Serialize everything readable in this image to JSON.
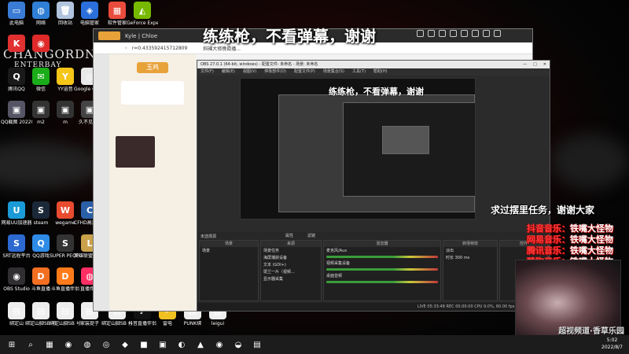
{
  "desktop": {
    "icons_col1": [
      {
        "label": "此电脑",
        "color": "#3a7bd5",
        "glyph": "▭"
      },
      {
        "label": "",
        "color": "#e03030",
        "glyph": "K"
      },
      {
        "label": "腾讯QQ",
        "color": "#1a1a1a",
        "glyph": "Q"
      },
      {
        "label": "QQ截图 20220802...",
        "color": "#556",
        "glyph": "▣"
      },
      {
        "label": "",
        "color": "#222",
        "glyph": ""
      },
      {
        "label": "",
        "color": "#222",
        "glyph": ""
      },
      {
        "label": "网易UU加速器",
        "color": "#1a9bd7",
        "glyph": "U"
      },
      {
        "label": "SRT远程平台",
        "color": "#2c6ad2",
        "glyph": "S"
      },
      {
        "label": "OBS Studio",
        "color": "#302e31",
        "glyph": "◉"
      },
      {
        "label": "绑定山",
        "color": "#eee",
        "glyph": "▤"
      }
    ],
    "icons_col2": [
      {
        "label": "网络",
        "color": "#2f7fd6",
        "glyph": "◍"
      },
      {
        "label": "",
        "color": "#e02a2a",
        "glyph": "◉"
      },
      {
        "label": "微信",
        "color": "#1aad19",
        "glyph": "✉"
      },
      {
        "label": "m2",
        "color": "#333",
        "glyph": "▣"
      },
      {
        "label": "",
        "color": "#222",
        "glyph": ""
      },
      {
        "label": "",
        "color": "#222",
        "glyph": ""
      },
      {
        "label": "steam",
        "color": "#1b2838",
        "glyph": "S"
      },
      {
        "label": "QQ游戏",
        "color": "#2e8be6",
        "glyph": "Q"
      },
      {
        "label": "斗鱼直播",
        "color": "#f36f21",
        "glyph": "D"
      },
      {
        "label": "绑定山脚SB 号 1",
        "color": "#eee",
        "glyph": "▤"
      }
    ],
    "icons_col3": [
      {
        "label": "回收站",
        "color": "#b0c4de",
        "glyph": "🗑"
      },
      {
        "label": "",
        "color": "#e8e8e8",
        "glyph": ""
      },
      {
        "label": "YY语音",
        "color": "#f5c518",
        "glyph": "Y"
      },
      {
        "label": "m",
        "color": "#333",
        "glyph": "▣"
      },
      {
        "label": "",
        "color": "#222",
        "glyph": ""
      },
      {
        "label": "",
        "color": "#222",
        "glyph": ""
      },
      {
        "label": "wegame",
        "color": "#e84b2f",
        "glyph": "W"
      },
      {
        "label": "SUPER PEOPLE CBT",
        "color": "#333",
        "glyph": "S"
      },
      {
        "label": "斗鱼直播伴侣",
        "color": "#ff7b1a",
        "glyph": "D"
      },
      {
        "label": "绑定山脚SB 号 2",
        "color": "#eee",
        "glyph": "▤"
      }
    ],
    "icons_col4": [
      {
        "label": "电脑管家",
        "color": "#2a6fdb",
        "glyph": "◈"
      },
      {
        "label": "",
        "color": "#ddd",
        "glyph": ""
      },
      {
        "label": "Google Chrome",
        "color": "#e8e8e8",
        "glyph": "◎"
      },
      {
        "label": "久不见: 自",
        "color": "#444",
        "glyph": "▣"
      },
      {
        "label": "",
        "color": "#222",
        "glyph": ""
      },
      {
        "label": "",
        "color": "#222",
        "glyph": ""
      },
      {
        "label": "CFHD高清 竞技大区",
        "color": "#2b5fa8",
        "glyph": "C"
      },
      {
        "label": "英雄联盟 WeGame版",
        "color": "#c9a14a",
        "glyph": "L"
      },
      {
        "label": "直播伴侣",
        "color": "#ff2f64",
        "glyph": "◍"
      },
      {
        "label": "家装提子",
        "color": "#eee",
        "glyph": "▤"
      }
    ],
    "icons_extra": [
      {
        "label": "软件管家",
        "color": "#e94b3c",
        "glyph": "▦"
      },
      {
        "label": "GeForce Experience",
        "color": "#76b900",
        "glyph": "◭"
      },
      {
        "label": "绑定山脚SB 号 4",
        "color": "#eee",
        "glyph": "▤"
      },
      {
        "label": "抖音直播伴侣",
        "color": "#111",
        "glyph": "♪"
      },
      {
        "label": "雷电",
        "color": "#f0c020",
        "glyph": "⚡"
      },
      {
        "label": "PUNK绑",
        "color": "#eee",
        "glyph": "▤"
      },
      {
        "label": "leigui",
        "color": "#eee",
        "glyph": "▤"
      }
    ],
    "logo_line1": "CHANGORDN",
    "logo_line2": "ENTERBAY"
  },
  "banner_text": "练练枪，不看弹幕，谢谢",
  "browser": {
    "tab_text": "Kyle | Chloe",
    "url": "r=0.433592415712809",
    "page_title": "斜裸大修晚霞播...",
    "content_brand": "玉鸡"
  },
  "obs": {
    "window_title": "OBS 27.0.1 (64-bit, windows) - 配置文件: 未命名 - 场景: 未命名",
    "menu": [
      "文件(F)",
      "编辑(E)",
      "视图(V)",
      "停靠部件(D)",
      "配置文件(P)",
      "场景集合(S)",
      "工具(T)",
      "帮助(H)"
    ],
    "preview_banner": "练练枪，不看弹幕，谢谢",
    "dock_label": "未选择源",
    "props_button": "属性",
    "filters_button": "滤镜",
    "scenes_header": "场景",
    "scenes": [
      "场景"
    ],
    "sources_header": "来源",
    "sources": [
      "场景任务",
      "海屏捕获设备",
      "文本 (GDI+)",
      "斑兰一片（视频...",
      "显示器采集"
    ],
    "mixer_header": "混音器",
    "mixer": [
      {
        "name": "麦克风/Aux",
        "db": "0.0 dB"
      },
      {
        "name": "视频采集设备",
        "db": "0.0 dB"
      },
      {
        "name": "桌面音频",
        "db": "0.0 dB"
      }
    ],
    "transitions_header": "转场特效",
    "transition": "淡出",
    "duration_label": "时长",
    "duration": "300 ms",
    "controls_header": "控件",
    "status": "LIVE 05:33:48   REC 00:00:00   CPU 9.0%, 60.00 fps"
  },
  "overlay": {
    "thanks": "求过摆里任务，谢谢大家",
    "music_lines": [
      {
        "label": "抖音音乐：",
        "value": "铁嘴大怪物"
      },
      {
        "label": "网易音乐：",
        "value": "铁嘴大怪物"
      },
      {
        "label": "腾讯音乐：",
        "value": "铁嘴大怪物"
      },
      {
        "label": "酷狗音乐：",
        "value": "铁嘴大怪物"
      }
    ],
    "cam_text": "超视频道·香草乐园"
  },
  "taskbar": {
    "time": "5:02",
    "date": "2022/8/7",
    "apps": [
      "⊞",
      "⌕",
      "▦",
      "◉",
      "◍",
      "◎",
      "◆",
      "■",
      "▣",
      "◐",
      "▲",
      "◉",
      "◒",
      "▤"
    ]
  }
}
